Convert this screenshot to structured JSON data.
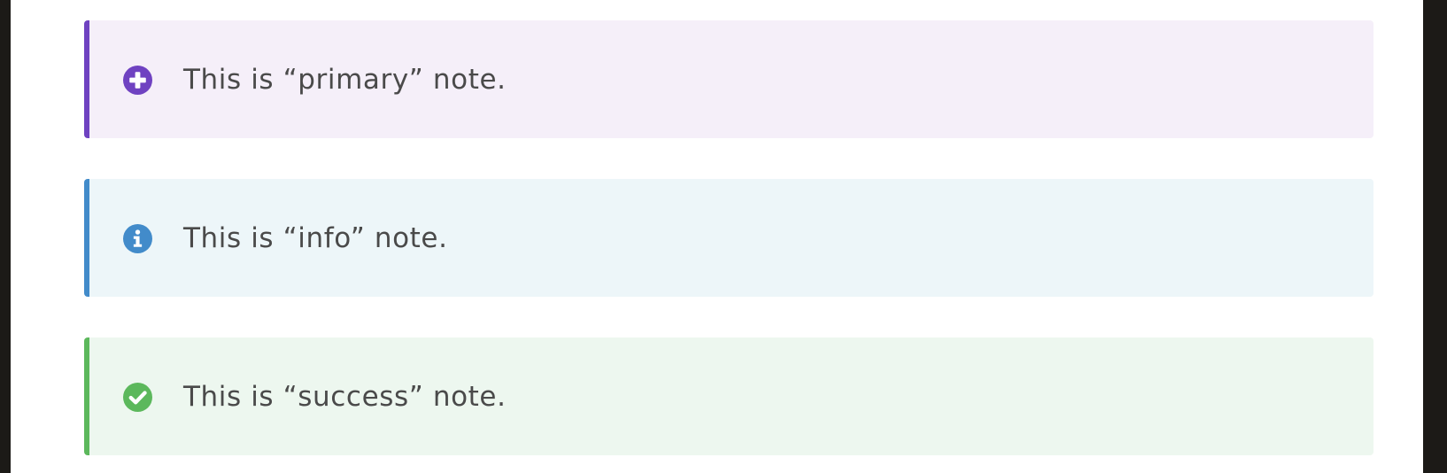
{
  "notes": [
    {
      "type": "primary",
      "icon": "plus-circle-icon",
      "color": "#6f42c1",
      "background": "#f5eff9",
      "text": "This is “primary” note."
    },
    {
      "type": "info",
      "icon": "info-circle-icon",
      "color": "#428bca",
      "background": "#edf6f9",
      "text": "This is “info” note."
    },
    {
      "type": "success",
      "icon": "check-circle-icon",
      "color": "#5cb85c",
      "background": "#edf7ef",
      "text": "This is “success” note."
    }
  ]
}
